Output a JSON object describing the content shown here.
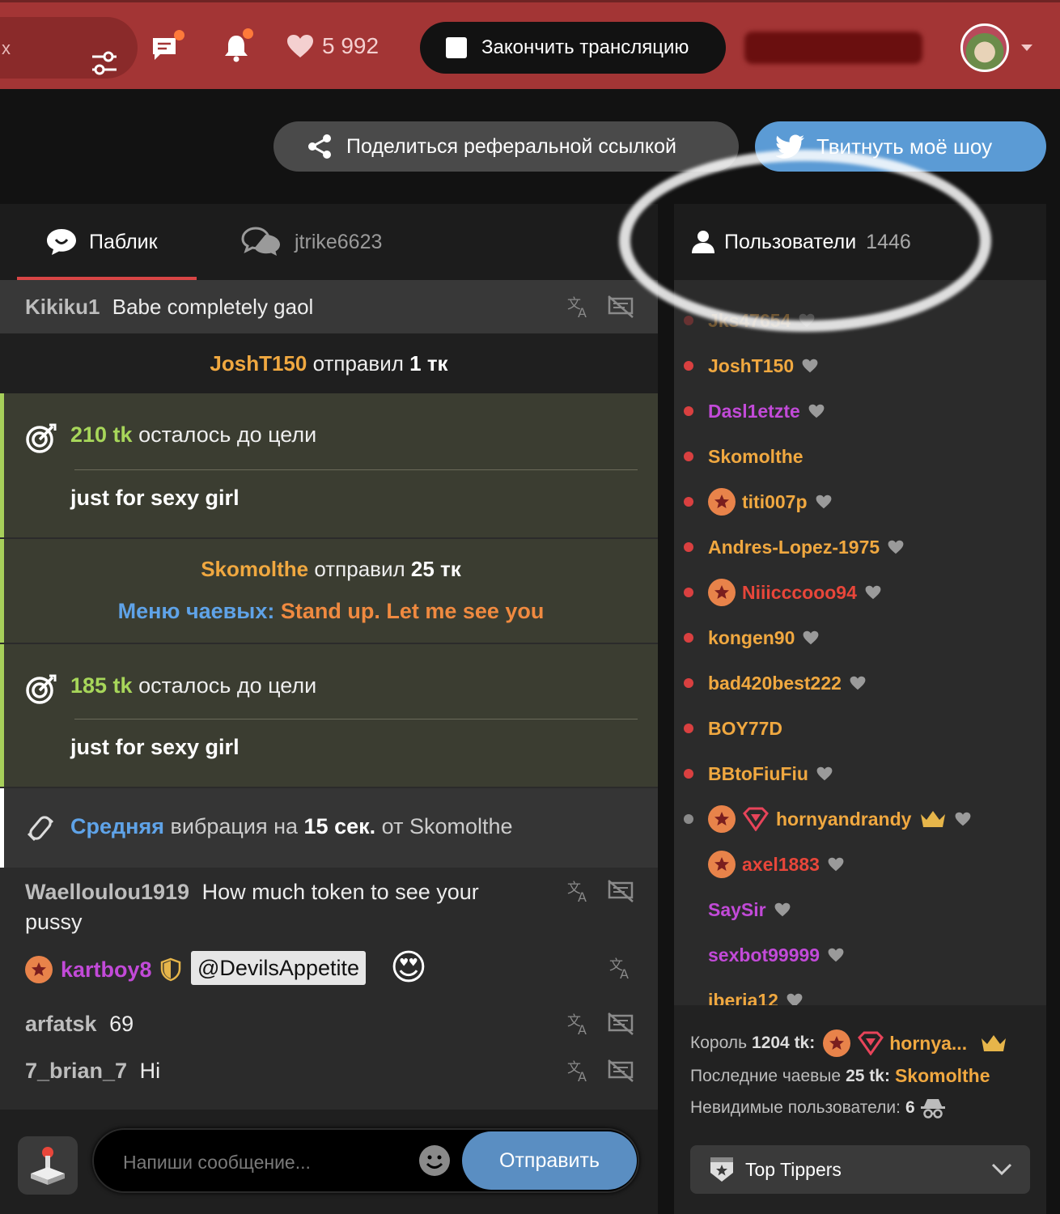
{
  "header": {
    "search_fragment": "x",
    "likes_count": "5 992",
    "end_stream_label": "Закончить трансляцию",
    "icons": [
      "filter-icon",
      "chat-icon",
      "bell-icon",
      "heart-icon",
      "avatar"
    ]
  },
  "actions": {
    "share_label": "Поделиться реферальной ссылкой",
    "tweet_label": "Твитнуть моё шоу"
  },
  "chat": {
    "tabs": [
      {
        "label": "Паблик",
        "active": true
      },
      {
        "label": "jtrike6623",
        "active": false
      }
    ],
    "msg1": {
      "user": "Kikiku1",
      "text": "Babe completely gaol"
    },
    "tip1": {
      "user": "JoshT150",
      "verb": "отправил",
      "amount": "1 тк"
    },
    "goal1": {
      "amount": "210 tk",
      "text": "осталось до цели",
      "goal": "just for sexy girl"
    },
    "tip2": {
      "user": "Skomolthe",
      "verb": "отправил",
      "amount": "25 тк",
      "menu_label": "Меню чаевых:",
      "menu_item": "Stand up. Let me see you"
    },
    "goal2": {
      "amount": "185 tk",
      "text": "осталось до цели",
      "goal": "just for sexy girl"
    },
    "vibe": {
      "level": "Средняя",
      "text1": "вибрация на",
      "duration": "15 сек.",
      "text2": "от",
      "user": "Skomolthe"
    },
    "msg2": {
      "user": "Waelloulou1919",
      "text1": "How much token to see your",
      "text2": "pussy"
    },
    "msg3": {
      "user": "kartboy8",
      "mention": "@DevilsAppetite",
      "emoji": "😍"
    },
    "msg4": {
      "user": "arfatsk",
      "text": "69"
    },
    "msg5": {
      "user": "7_brian_7",
      "text": "Hi"
    },
    "input_placeholder": "Напиши сообщение...",
    "send_label": "Отправить"
  },
  "users": {
    "title": "Пользователи",
    "count": "1446",
    "list": [
      {
        "name": "Jks47654",
        "color": "#f0a840"
      },
      {
        "name": "JoshT150",
        "color": "#f0a840"
      },
      {
        "name": "Dasl1etzte",
        "color": "#c24ad8"
      },
      {
        "name": "Skomolthe",
        "color": "#f0a840"
      },
      {
        "name": "titi007p",
        "color": "#f0a840"
      },
      {
        "name": "Andres-Lopez-1975",
        "color": "#f0a840"
      },
      {
        "name": "Niiicccooo94",
        "color": "#e8463a"
      },
      {
        "name": "kongen90",
        "color": "#f0a840"
      },
      {
        "name": "bad420best222",
        "color": "#f0a840"
      },
      {
        "name": "BOY77D",
        "color": "#f0a840"
      },
      {
        "name": "BBtoFiuFiu",
        "color": "#f0a840"
      },
      {
        "name": "hornyandrandy",
        "color": "#f0a840"
      },
      {
        "name": "axel1883",
        "color": "#e8463a"
      },
      {
        "name": "SaySir",
        "color": "#c24ad8"
      },
      {
        "name": "sexbot99999",
        "color": "#c24ad8"
      },
      {
        "name": "iberia12",
        "color": "#f0a840"
      }
    ],
    "king_label": "Король",
    "king_amount": "1204 tk:",
    "king_name": "hornya...",
    "last_tip_label": "Последние чаевые",
    "last_tip_amount": "25 tk:",
    "last_tip_user": "Skomolthe",
    "invisible_label": "Невидимые пользователи:",
    "invisible_count": "6",
    "top_tippers_label": "Top Tippers"
  }
}
